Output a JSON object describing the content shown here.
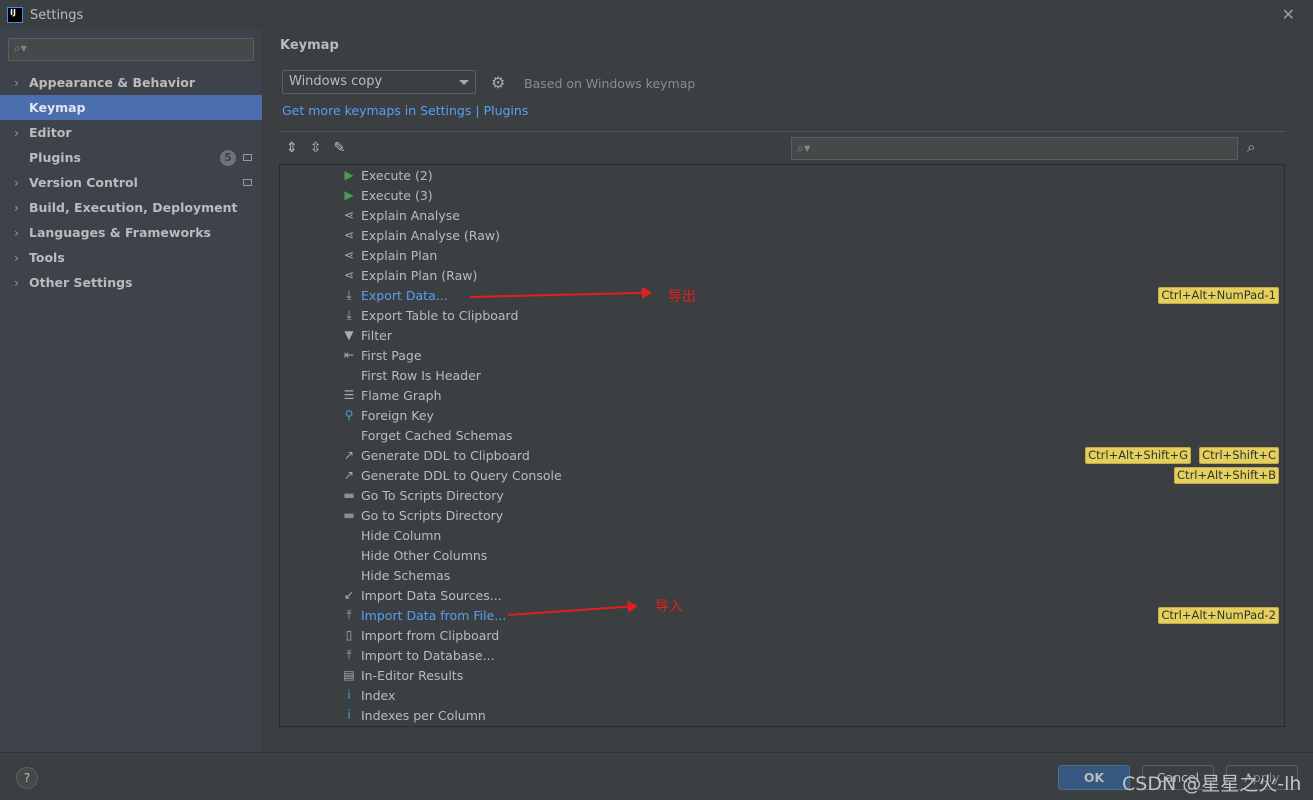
{
  "window": {
    "title": "Settings",
    "close": "✕"
  },
  "sidebar": {
    "search_placeholder": "",
    "items": [
      {
        "label": "Appearance & Behavior",
        "expandable": true
      },
      {
        "label": "Keymap",
        "selected": true
      },
      {
        "label": "Editor",
        "expandable": true
      },
      {
        "label": "Plugins",
        "badge": "5"
      },
      {
        "label": "Version Control",
        "expandable": true
      },
      {
        "label": "Build, Execution, Deployment",
        "expandable": true
      },
      {
        "label": "Languages & Frameworks",
        "expandable": true
      },
      {
        "label": "Tools",
        "expandable": true
      },
      {
        "label": "Other Settings",
        "expandable": true
      }
    ]
  },
  "main": {
    "title": "Keymap",
    "keymap_value": "Windows copy",
    "based_on": "Based on Windows keymap",
    "link1": "Get more keymaps in Settings",
    "link_sep": " | ",
    "link2": "Plugins"
  },
  "actions": [
    {
      "label": "Execute (2)",
      "icon": "play-icon"
    },
    {
      "label": "Execute (3)",
      "icon": "play-icon"
    },
    {
      "label": "Explain Analyse",
      "icon": "explain-icon"
    },
    {
      "label": "Explain Analyse (Raw)",
      "icon": "explain-icon"
    },
    {
      "label": "Explain Plan",
      "icon": "explain-icon"
    },
    {
      "label": "Explain Plan (Raw)",
      "icon": "explain-icon"
    },
    {
      "label": "Export Data...",
      "icon": "download-icon",
      "link": true,
      "shortcuts": [
        "Ctrl+Alt+NumPad-1"
      ]
    },
    {
      "label": "Export Table to Clipboard",
      "icon": "download-icon"
    },
    {
      "label": "Filter",
      "icon": "filter-icon"
    },
    {
      "label": "First Page",
      "icon": "first-page-icon"
    },
    {
      "label": "First Row Is Header",
      "icon": ""
    },
    {
      "label": "Flame Graph",
      "icon": "flame-graph-icon"
    },
    {
      "label": "Foreign Key",
      "icon": "key-icon"
    },
    {
      "label": "Forget Cached Schemas",
      "icon": ""
    },
    {
      "label": "Generate DDL to Clipboard",
      "icon": "export-arrow-icon",
      "shortcuts": [
        "Ctrl+Alt+Shift+G",
        "Ctrl+Shift+C"
      ]
    },
    {
      "label": "Generate DDL to Query Console",
      "icon": "export-arrow-icon",
      "shortcuts": [
        "Ctrl+Alt+Shift+B"
      ]
    },
    {
      "label": "Go To Scripts Directory",
      "icon": "folder-icon"
    },
    {
      "label": "Go to Scripts Directory",
      "icon": "folder-icon"
    },
    {
      "label": "Hide Column",
      "icon": ""
    },
    {
      "label": "Hide Other Columns",
      "icon": ""
    },
    {
      "label": "Hide Schemas",
      "icon": ""
    },
    {
      "label": "Import Data Sources...",
      "icon": "import-icon"
    },
    {
      "label": "Import Data from File...",
      "icon": "upload-icon",
      "link": true,
      "shortcuts": [
        "Ctrl+Alt+NumPad-2"
      ]
    },
    {
      "label": "Import from Clipboard",
      "icon": "clipboard-icon"
    },
    {
      "label": "Import to Database...",
      "icon": "upload-icon"
    },
    {
      "label": "In-Editor Results",
      "icon": "table-icon"
    },
    {
      "label": "Index",
      "icon": "info-icon"
    },
    {
      "label": "Indexes per Column",
      "icon": "info-icon"
    }
  ],
  "annotations": {
    "export": "导出",
    "import": "导入"
  },
  "footer": {
    "help": "?",
    "ok": "OK",
    "cancel": "Cancel",
    "apply": "Apply",
    "watermark": "CSDN @星星之火-lh"
  },
  "colors": {
    "accent": "#4b6eaf",
    "link": "#589df6",
    "shortcut": "#e4d05c",
    "annotation": "#e02020"
  }
}
